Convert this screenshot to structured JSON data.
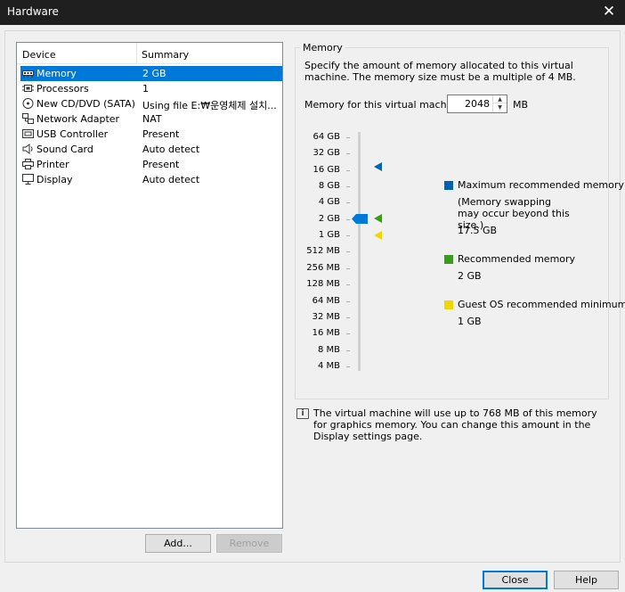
{
  "window": {
    "title": "Hardware",
    "close_glyph": "✕"
  },
  "device_list": {
    "columns": {
      "device": "Device",
      "summary": "Summary"
    },
    "rows": [
      {
        "icon": "memory-icon",
        "name": "Memory",
        "summary": "2 GB",
        "selected": true
      },
      {
        "icon": "processor-icon",
        "name": "Processors",
        "summary": "1"
      },
      {
        "icon": "cd-dvd-icon",
        "name": "New CD/DVD (SATA)",
        "summary": "Using file E:₩운영체제 설치..."
      },
      {
        "icon": "network-adapter-icon",
        "name": "Network Adapter",
        "summary": "NAT"
      },
      {
        "icon": "usb-controller-icon",
        "name": "USB Controller",
        "summary": "Present"
      },
      {
        "icon": "sound-card-icon",
        "name": "Sound Card",
        "summary": "Auto detect"
      },
      {
        "icon": "printer-icon",
        "name": "Printer",
        "summary": "Present"
      },
      {
        "icon": "display-icon",
        "name": "Display",
        "summary": "Auto detect"
      }
    ]
  },
  "buttons": {
    "add": "Add...",
    "remove": "Remove",
    "close": "Close",
    "help": "Help"
  },
  "memory": {
    "group_label": "Memory",
    "description": "Specify the amount of memory allocated to this virtual machine. The memory size must be a multiple of 4 MB.",
    "field_label": "Memory for this virtual machine:",
    "value": "2048",
    "unit": "MB",
    "scale_labels": [
      "64 GB",
      "32 GB",
      "16 GB",
      "8 GB",
      "4 GB",
      "2 GB",
      "1 GB",
      "512 MB",
      "256 MB",
      "128 MB",
      "64 MB",
      "32 MB",
      "16 MB",
      "8 MB",
      "4 MB"
    ],
    "legend": {
      "max": {
        "label": "Maximum recommended memory",
        "note": "(Memory swapping may occur beyond this size.)",
        "value": "17.5 GB",
        "color": "#0063b1"
      },
      "recommended": {
        "label": "Recommended memory",
        "value": "2 GB",
        "color": "#3c9a1f"
      },
      "guest_min": {
        "label": "Guest OS recommended minimum",
        "value": "1 GB",
        "color": "#f2d600"
      }
    },
    "slider_color": "#0078d7"
  },
  "info": {
    "icon": "info-icon",
    "text": "The virtual machine will use up to 768 MB of this memory for graphics memory. You can change this amount in the Display settings page."
  }
}
